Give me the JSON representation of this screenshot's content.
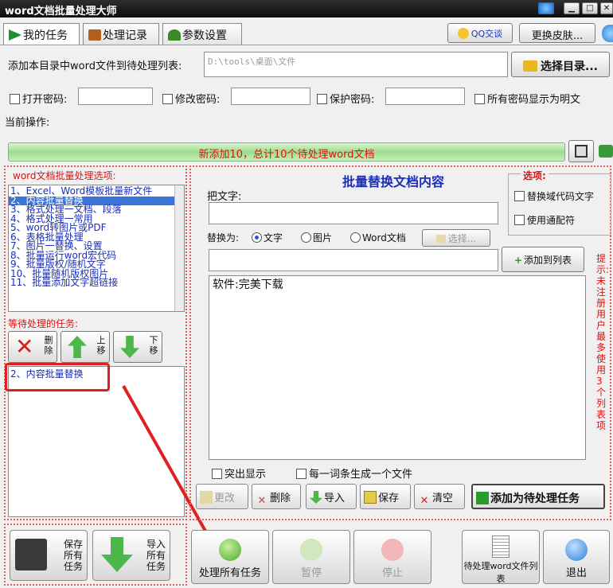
{
  "window": {
    "title": "word文档批量处理大师"
  },
  "tabs": [
    {
      "label": "我的任务"
    },
    {
      "label": "处理记录"
    },
    {
      "label": "参数设置"
    }
  ],
  "header": {
    "qq_label": "QQ交谈",
    "skin_button": "更换皮肤..."
  },
  "dir_row": {
    "label": "添加本目录中word文件到待处理列表:",
    "path_value": "D:\\tools\\桌面\\文件",
    "select_button": "选择目录..."
  },
  "passwords": {
    "open_label": "打开密码:",
    "modify_label": "修改密码:",
    "protect_label": "保护密码:",
    "show_plain_label": "所有密码显示为明文"
  },
  "current_op_label": "当前操作:",
  "progress": {
    "text": "新添加10，总计10个待处理word文档"
  },
  "options_title": "word文档批量处理选项:",
  "options_list": [
    "1、Excel、Word模板批量新文件",
    "2、内容批量替换",
    "3、格式处理一文档、段落",
    "4、格式处理一常用",
    "5、word转图片或PDF",
    "6、表格批量处理",
    "7、图片一替换、设置",
    "8、批量运行word宏代码",
    "9、批量版权/随机文字",
    "10、批量随机版权图片",
    "11、批量添加文字超链接"
  ],
  "pending": {
    "title": "等待处理的任务:",
    "delete_label": "删除",
    "up_label": "上移",
    "down_label": "下移",
    "tasks": [
      "2、内容批量替换"
    ]
  },
  "replace_panel": {
    "title": "批量替换文档内容",
    "find_label": "把文字:",
    "replace_label": "替换为:",
    "radio_text": "文字",
    "radio_image": "图片",
    "radio_word": "Word文档",
    "choose_button": "选择...",
    "add_to_list_button": "添加到列表",
    "list_items": [
      "软件:完美下载"
    ],
    "highlight_label": "突出显示",
    "per_entry_label": "每一词条生成一个文件"
  },
  "options_box": {
    "title": "选项:",
    "replace_field_code": "替换域代码文字",
    "use_wildcard": "使用通配符"
  },
  "side_hint": "提示:未注册用户最多使用3个列表项",
  "action_buttons": {
    "modify": "更改",
    "delete": "删除",
    "import": "导入",
    "save": "保存",
    "clear": "清空",
    "add_task": "添加为待处理任务"
  },
  "bottom": {
    "save_all": "保存所有任务",
    "import_all": "导入所有任务",
    "process_all": "处理所有任务",
    "pause": "暂停",
    "stop": "停止",
    "pending_list": "待处理word文件列表",
    "exit": "退出"
  },
  "colors": {
    "accent": "#1a2eb8",
    "alert": "#e01010",
    "selection": "#3b74d8"
  }
}
